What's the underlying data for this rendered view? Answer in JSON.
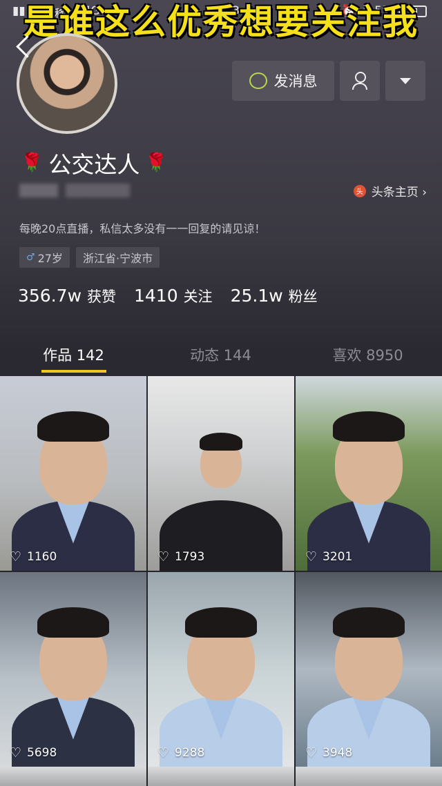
{
  "status_bar": {
    "carrier": "中国移动",
    "network": "4G",
    "time": "14:13",
    "battery": "55%"
  },
  "caption": "是谁这么优秀想要关注我",
  "header": {
    "send_message_label": "发消息",
    "icons": [
      "back-icon",
      "chat-icon",
      "person-check-icon",
      "dropdown-icon"
    ]
  },
  "profile": {
    "nickname": "公交达人",
    "toutiao_label": "头条主页 ›",
    "bio": "每晚20点直播，私信太多没有一一回复的请见谅！",
    "age_tag": "27岁",
    "location_tag": "浙江省·宁波市"
  },
  "stats": {
    "likes_num": "356.7w",
    "likes_label": "获赞",
    "following_num": "1410",
    "following_label": "关注",
    "followers_num": "25.1w",
    "followers_label": "粉丝"
  },
  "tabs": [
    {
      "label": "作品 142",
      "active": true
    },
    {
      "label": "动态 144",
      "active": false
    },
    {
      "label": "喜欢 8950",
      "active": false
    }
  ],
  "videos": [
    {
      "likes": "1160"
    },
    {
      "likes": "1793"
    },
    {
      "likes": "3201"
    },
    {
      "likes": "5698"
    },
    {
      "likes": "9288"
    },
    {
      "likes": "3948"
    }
  ],
  "colors": {
    "caption": "#f5e01a",
    "tab_indicator": "#f2c624",
    "button_bg": "#55525b"
  }
}
